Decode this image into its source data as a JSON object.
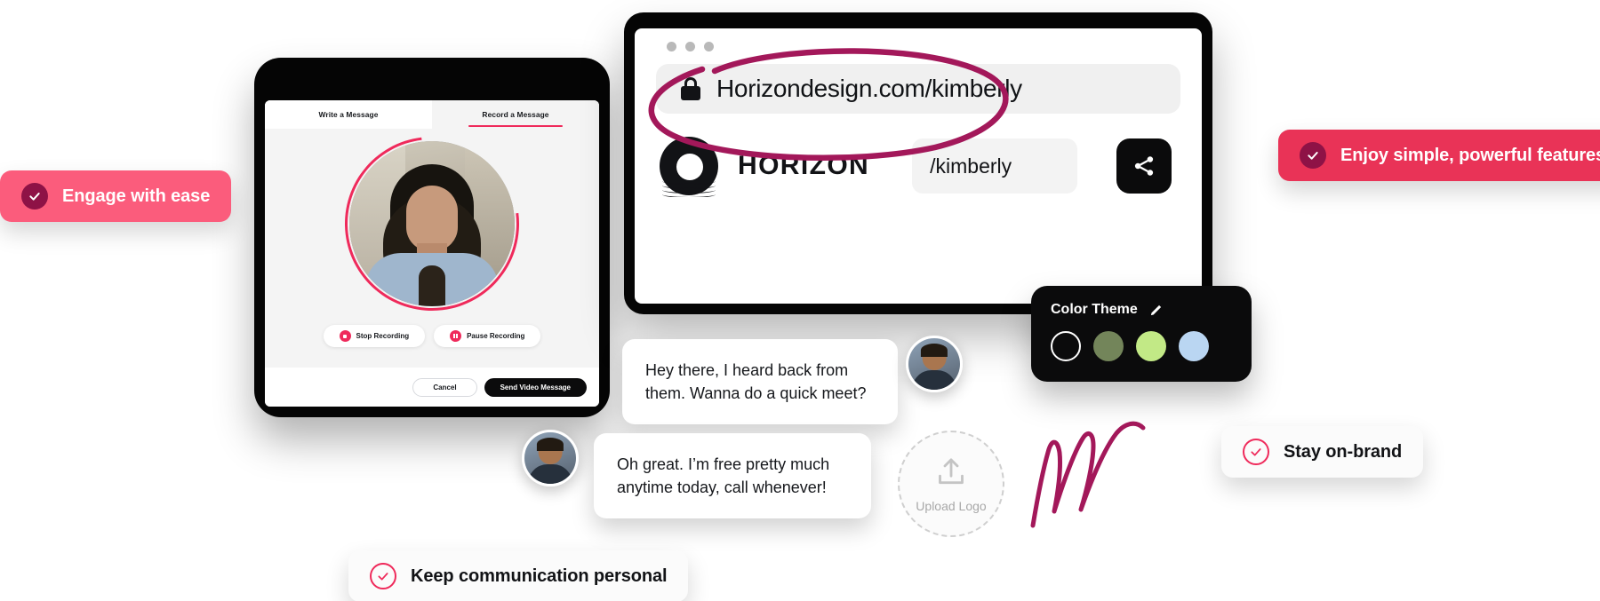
{
  "tablet": {
    "tabs": [
      {
        "label": "Write a Message",
        "active": false
      },
      {
        "label": "Record a Message",
        "active": true
      }
    ],
    "recording_controls": [
      {
        "label": "Stop Recording",
        "icon": "stop-icon"
      },
      {
        "label": "Pause Recording",
        "icon": "pause-icon"
      }
    ],
    "actions": {
      "cancel_label": "Cancel",
      "send_label": "Send Video Message"
    }
  },
  "browser": {
    "window_dots": 3,
    "lock_icon": "lock-icon",
    "url": "Horizondesign.com/kimberly",
    "brand": {
      "logo_icon": "horizon-logo-icon",
      "name": "HORIZON"
    },
    "slug_value": "/kimberly",
    "share_icon": "share-icon"
  },
  "theme_panel": {
    "title": "Color Theme",
    "edit_icon": "pencil-icon",
    "swatches": [
      {
        "name": "black",
        "color": "#0b0b0c",
        "selected": true
      },
      {
        "name": "olive",
        "color": "#73855a",
        "selected": false
      },
      {
        "name": "light-green",
        "color": "#c2e986",
        "selected": false
      },
      {
        "name": "light-blue",
        "color": "#bad6f2",
        "selected": false
      }
    ]
  },
  "chat": {
    "messages": [
      {
        "text": "Hey there, I heard back from them. Wanna do a quick meet?",
        "avatar": "avatar-right"
      },
      {
        "text": "Oh great. I’m free pretty much anytime today, call whenever!",
        "avatar": "avatar-left"
      }
    ]
  },
  "upload": {
    "label": "Upload Logo",
    "icon": "upload-icon"
  },
  "badges": [
    {
      "text": "Engage with ease",
      "style": "pink-solid",
      "icon": "check-circle-icon"
    },
    {
      "text": "Enjoy simple, powerful features",
      "style": "crimson-solid",
      "icon": "check-circle-icon"
    },
    {
      "text": "Stay on-brand",
      "style": "white",
      "icon": "check-circle-outline-icon"
    },
    {
      "text": "Keep communication personal",
      "style": "white",
      "icon": "check-circle-outline-icon"
    }
  ],
  "colors": {
    "accent_pink": "#ef2a5b",
    "badge_pink": "#fb5c7c",
    "badge_crimson": "#e93357",
    "check_dark": "#8e1246",
    "scribble": "#a3185a",
    "device_black": "#050505"
  }
}
